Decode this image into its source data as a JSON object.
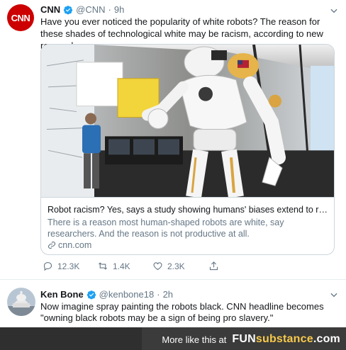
{
  "tweet": {
    "author_name": "CNN",
    "author_handle": "@CNN",
    "separator": "·",
    "time": "9h",
    "avatar_text": "CNN",
    "text": "Have you ever noticed the popularity of white robots? The reason for these shades of technological white may be racism, according to new research.",
    "card": {
      "title": "Robot racism? Yes, says a study showing humans' biases extend to rob...",
      "description": "There is a reason most human-shaped robots are white, say researchers. And the reason is not productive at all.",
      "domain": "cnn.com"
    },
    "actions": {
      "replies": "12.3K",
      "retweets": "1.4K",
      "likes": "2.3K"
    }
  },
  "reply": {
    "author_name": "Ken Bone",
    "author_handle": "@kenbone18",
    "separator": "·",
    "time": "2h",
    "text": "Now imagine spray painting the robots black. CNN headline becomes \"owning black robots may be a sign of being pro slavery.\""
  },
  "footer": {
    "more_text": "More like this at",
    "brand_fun": "FUN",
    "brand_sub": "substance",
    "brand_tld": ".com"
  },
  "colors": {
    "verified": "#1da1f2",
    "cnn_red": "#cc0000",
    "muted": "#657786",
    "brand_accent": "#f7c94a"
  }
}
